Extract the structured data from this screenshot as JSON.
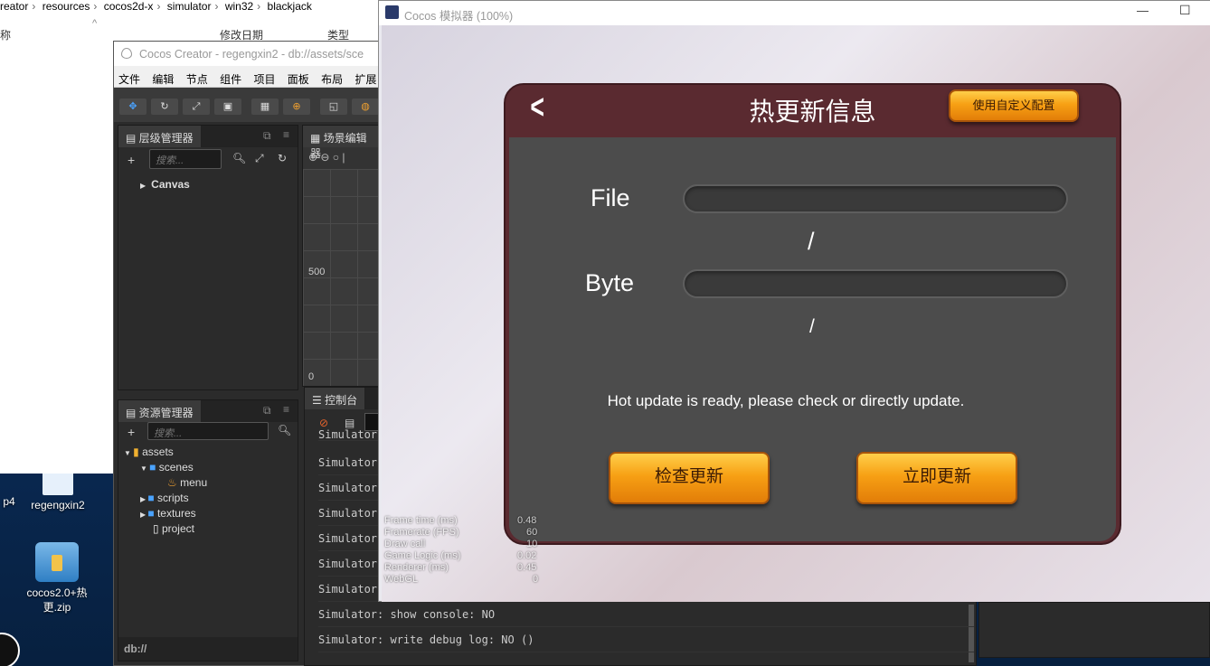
{
  "explorer": {
    "breadcrumb": [
      "reator",
      "resources",
      "cocos2d-x",
      "simulator",
      "win32",
      "blackjack"
    ],
    "columns": {
      "name": "称",
      "modified": "修改日期",
      "type": "类型"
    }
  },
  "desktop": {
    "icons": [
      {
        "label": "p4"
      },
      {
        "label": "regengxin2"
      },
      {
        "label": "cocos2.0+热更.zip"
      }
    ]
  },
  "creator": {
    "title": "Cocos Creator - regengxin2 - db://assets/sce",
    "menu": [
      "文件",
      "编辑",
      "节点",
      "组件",
      "项目",
      "面板",
      "布局",
      "扩展"
    ],
    "hierarchy": {
      "tab": "层级管理器",
      "search_placeholder": "搜索...",
      "root": "Canvas"
    },
    "scene": {
      "tab": "场景编辑器",
      "tick_500": "500",
      "tick_0": "0"
    },
    "assets": {
      "tab": "资源管理器",
      "search_placeholder": "搜索...",
      "tree": [
        "assets",
        "scenes",
        "menu",
        "scripts",
        "textures",
        "project"
      ],
      "footer": "db://"
    },
    "console": {
      "tab": "控制台",
      "lines": [
        "Simulator: ",
        "Simulator: ",
        "Simulator: ",
        "Simulator: ",
        "Simulator: ",
        "Simulator: ",
        "Simulator: show console: NO",
        "Simulator: write debug log: NO ()"
      ]
    }
  },
  "simulator": {
    "title": "Cocos 模拟器 (100%)",
    "window_controls": {
      "minimize": "—",
      "maximize": "☐"
    },
    "dialog": {
      "title": "热更新信息",
      "custom_button": "使用自定义配置",
      "file_label": "File",
      "file_progress": 0,
      "file_sep": "/",
      "byte_label": "Byte",
      "byte_progress": 0,
      "byte_sep": "/",
      "message": "Hot update is ready, please check or directly update.",
      "check_button": "检查更新",
      "update_button": "立即更新"
    },
    "stats": [
      {
        "label": "Frame time (ms)",
        "value": "0.48"
      },
      {
        "label": "Framerate (FPS)",
        "value": "60"
      },
      {
        "label": "Draw call",
        "value": "10"
      },
      {
        "label": "Game Logic (ms)",
        "value": "0.02"
      },
      {
        "label": "Renderer (ms)",
        "value": "0.45"
      },
      {
        "label": "WebGL",
        "value": "0"
      }
    ]
  }
}
